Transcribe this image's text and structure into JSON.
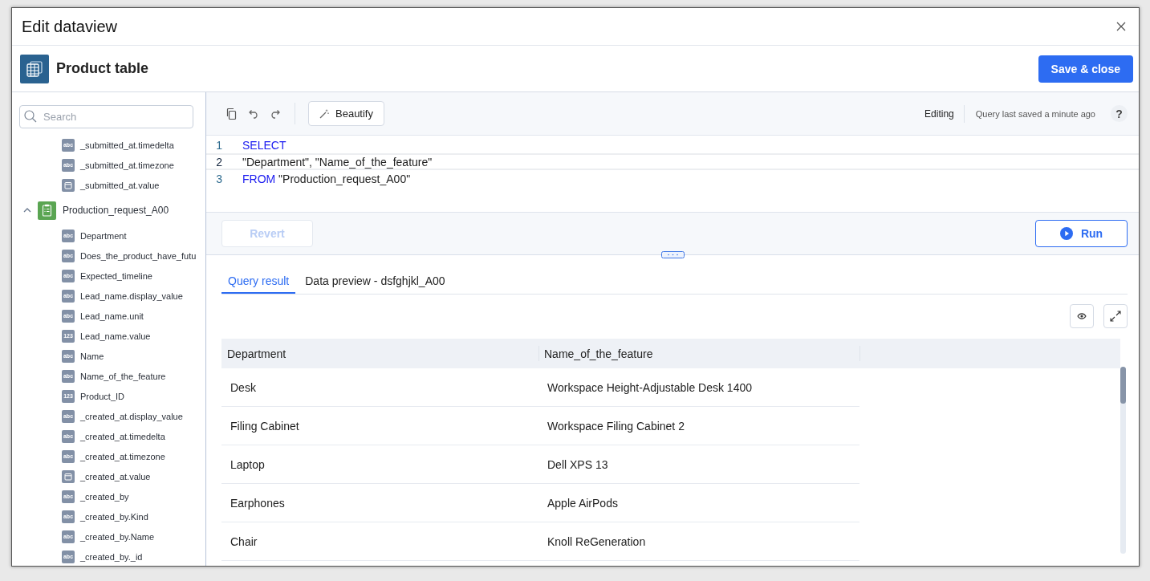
{
  "window": {
    "title": "Edit dataview"
  },
  "header": {
    "title": "Product table",
    "save_button": "Save & close"
  },
  "sidebar": {
    "search": {
      "placeholder": "Search"
    },
    "items": [
      {
        "kind": "field",
        "label": "_submitted_at.timedelta",
        "badge": "abc"
      },
      {
        "kind": "field",
        "label": "_submitted_at.timezone",
        "badge": "abc"
      },
      {
        "kind": "date",
        "label": "_submitted_at.value"
      },
      {
        "kind": "table",
        "label": "Production_request_A00",
        "expanded": true,
        "children": [
          {
            "kind": "field",
            "label": "Department",
            "badge": "abc"
          },
          {
            "kind": "field",
            "label": "Does_the_product_have_futu",
            "badge": "abc"
          },
          {
            "kind": "field",
            "label": "Expected_timeline",
            "badge": "abc"
          },
          {
            "kind": "field",
            "label": "Lead_name.display_value",
            "badge": "abc"
          },
          {
            "kind": "field",
            "label": "Lead_name.unit",
            "badge": "abc"
          },
          {
            "kind": "field",
            "label": "Lead_name.value",
            "badge": "123"
          },
          {
            "kind": "field",
            "label": "Name",
            "badge": "abc"
          },
          {
            "kind": "field",
            "label": "Name_of_the_feature",
            "badge": "abc"
          },
          {
            "kind": "field",
            "label": "Product_ID",
            "badge": "123"
          },
          {
            "kind": "field",
            "label": "_created_at.display_value",
            "badge": "abc"
          },
          {
            "kind": "field",
            "label": "_created_at.timedelta",
            "badge": "abc"
          },
          {
            "kind": "field",
            "label": "_created_at.timezone",
            "badge": "abc"
          },
          {
            "kind": "date",
            "label": "_created_at.value"
          },
          {
            "kind": "field",
            "label": "_created_by",
            "badge": "abc"
          },
          {
            "kind": "field",
            "label": "_created_by.Kind",
            "badge": "abc"
          },
          {
            "kind": "field",
            "label": "_created_by.Name",
            "badge": "abc"
          },
          {
            "kind": "field",
            "label": "_created_by._id",
            "badge": "abc"
          }
        ]
      }
    ]
  },
  "editor": {
    "beautify": "Beautify",
    "mode": "Editing",
    "status": "Query last saved a minute ago",
    "help": "?",
    "lines": [
      {
        "number": "1",
        "current": false,
        "tokens": [
          {
            "kind": "keyword",
            "text": "SELECT"
          }
        ]
      },
      {
        "number": "2",
        "current": true,
        "tokens": [
          {
            "kind": "string",
            "text": "\"Department\", \"Name_of_the_feature\""
          }
        ]
      },
      {
        "number": "3",
        "current": false,
        "tokens": [
          {
            "kind": "keyword",
            "text": "FROM"
          },
          {
            "kind": "string",
            "text": " \"Production_request_A00\""
          }
        ]
      }
    ],
    "revert": {
      "label": "Revert",
      "disabled": true
    },
    "run": {
      "label": "Run"
    }
  },
  "results": {
    "tabs": [
      {
        "label": "Query result",
        "selected": true
      },
      {
        "label": "Data preview - dsfghjkl_A00",
        "selected": false
      }
    ],
    "table": {
      "columns": [
        "Department",
        "Name_of_the_feature"
      ],
      "rows": [
        [
          "Desk",
          "Workspace Height-Adjustable Desk 1400"
        ],
        [
          "Filing Cabinet",
          "Workspace Filing Cabinet 2"
        ],
        [
          "Laptop",
          "Dell XPS 13"
        ],
        [
          "Earphones",
          "Apple AirPods"
        ],
        [
          "Chair",
          "Knoll ReGeneration"
        ]
      ]
    }
  }
}
